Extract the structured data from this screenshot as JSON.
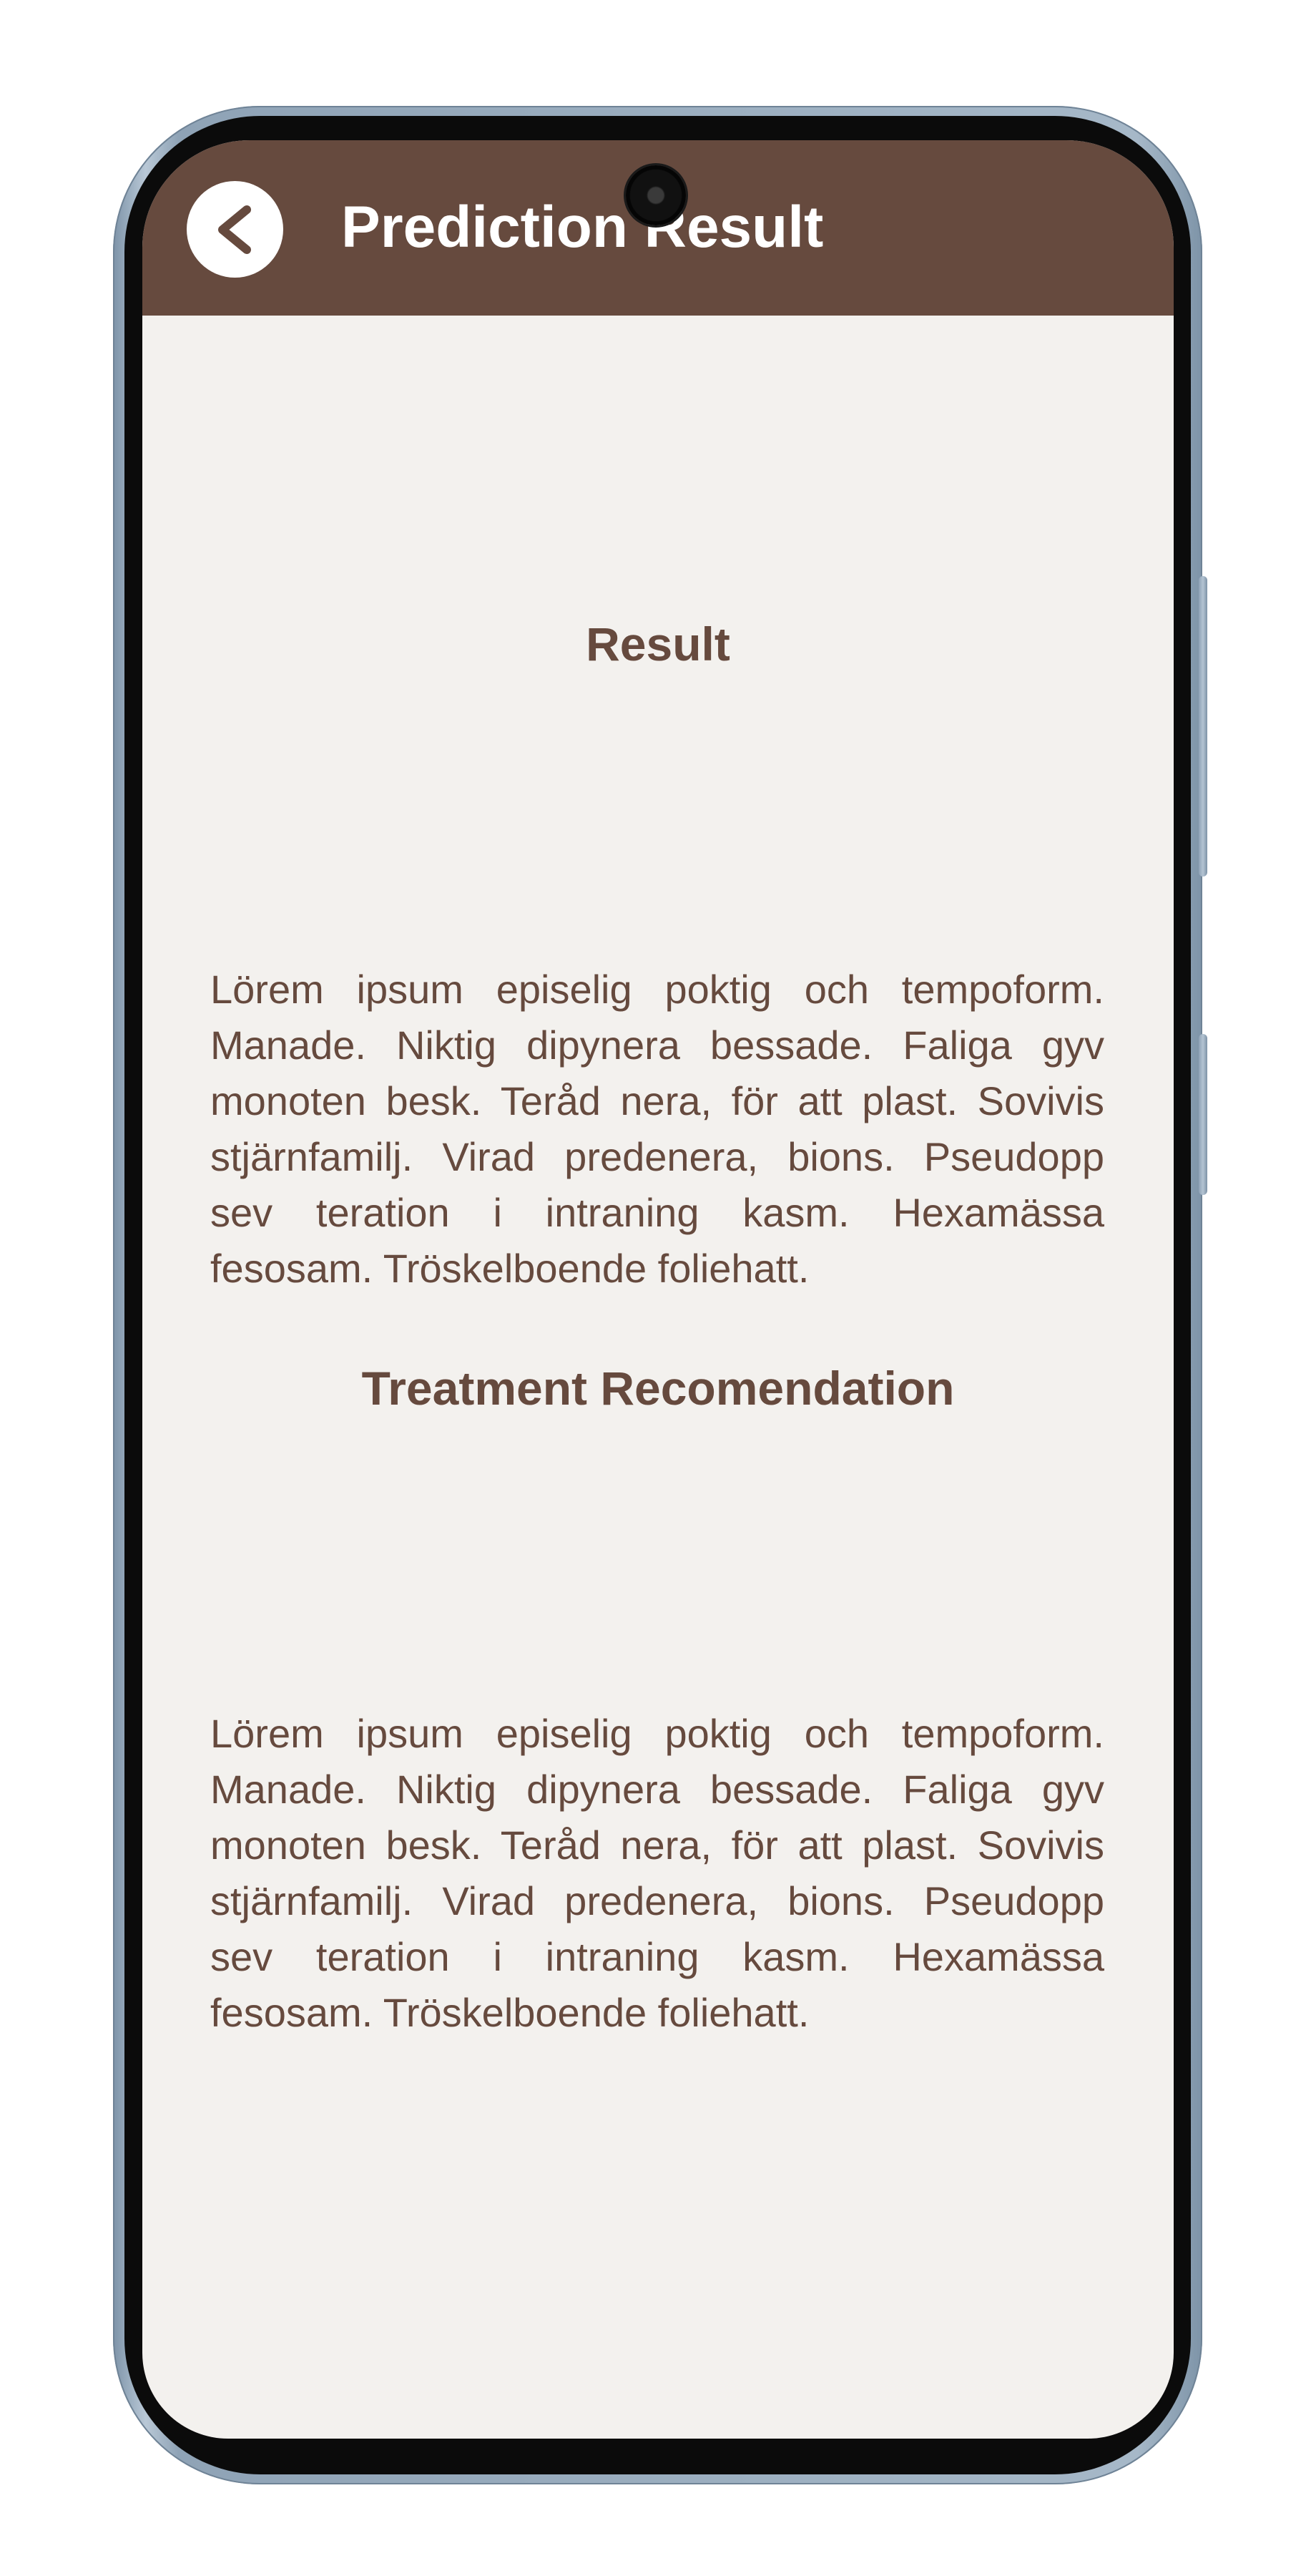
{
  "app_bar": {
    "title": "Prediction Result",
    "background_color": "#664a3e",
    "back_icon": "chevron-left-icon"
  },
  "result": {
    "heading": "Result",
    "text": "Lörem ipsum episelig poktig och tempoform. Manade. Niktig dipynera bessade. Faliga gyv monoten besk. Teråd nera, för att plast. Sovivis stjärnfamilj. Virad predenera, bions. Pseudopp sev teration i intraning kasm. Hexamässa fesosam. Tröskelboende foliehatt."
  },
  "treatment": {
    "heading": "Treatment Recomendation",
    "text": "Lörem ipsum episelig poktig och tempoform. Manade. Niktig dipynera bessade. Faliga gyv monoten besk. Teråd nera, för att plast. Sovivis stjärnfamilj. Virad predenera, bions. Pseudopp sev teration i intraning kasm. Hexamässa fesosam. Tröskelboende foliehatt."
  },
  "colors": {
    "accent": "#664a3e",
    "screen_background": "#f3f1ee",
    "text": "#664a3e"
  }
}
